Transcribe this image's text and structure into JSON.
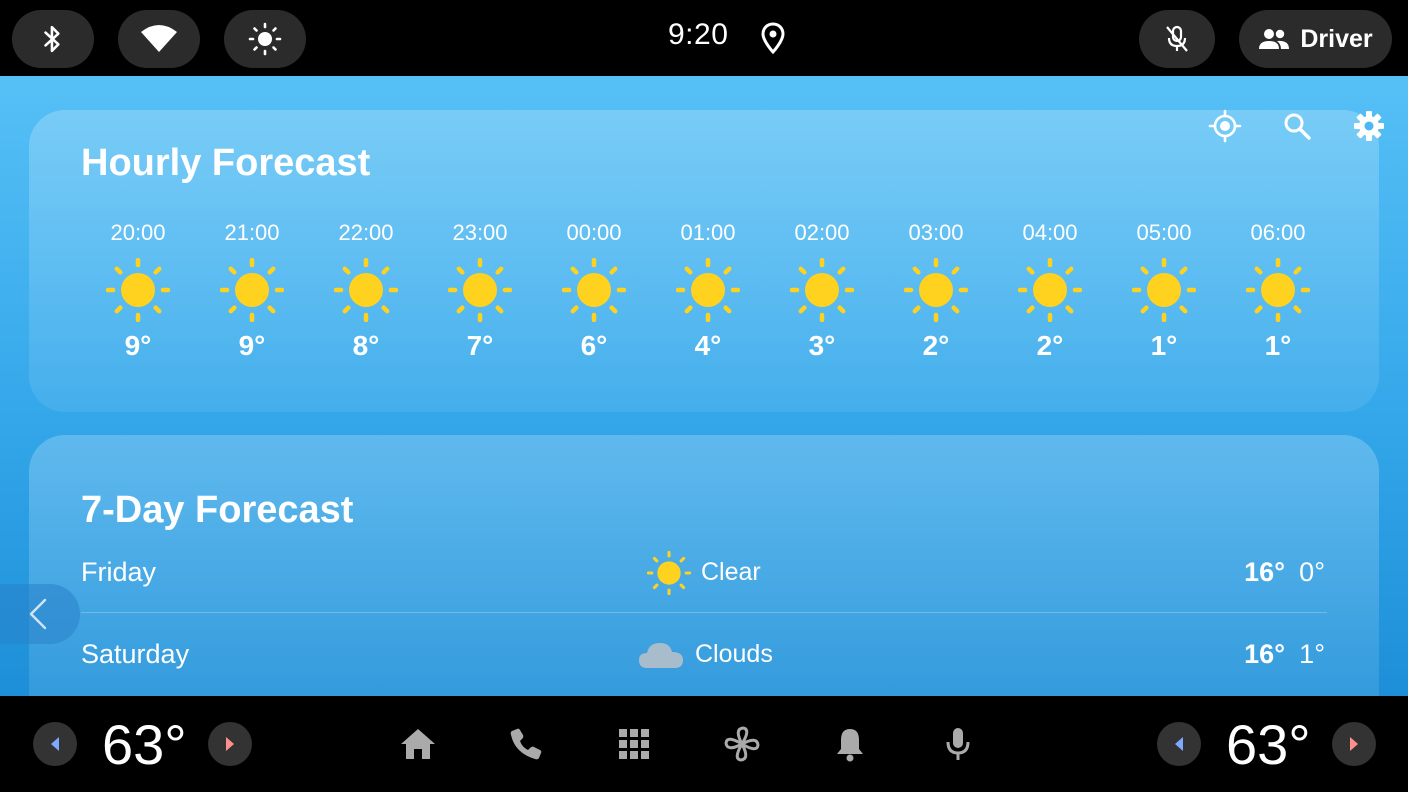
{
  "status_bar": {
    "time": "9:20",
    "driver_label": "Driver",
    "icons": [
      "bluetooth-icon",
      "wifi-icon",
      "brightness-icon",
      "location-pin-icon",
      "mic-off-icon",
      "people-icon"
    ]
  },
  "hourly": {
    "title": "Hourly Forecast",
    "items": [
      {
        "time": "20:00",
        "temp": "9°",
        "icon": "sun-icon"
      },
      {
        "time": "21:00",
        "temp": "9°",
        "icon": "sun-icon"
      },
      {
        "time": "22:00",
        "temp": "8°",
        "icon": "sun-icon"
      },
      {
        "time": "23:00",
        "temp": "7°",
        "icon": "sun-icon"
      },
      {
        "time": "00:00",
        "temp": "6°",
        "icon": "sun-icon"
      },
      {
        "time": "01:00",
        "temp": "4°",
        "icon": "sun-icon"
      },
      {
        "time": "02:00",
        "temp": "3°",
        "icon": "sun-icon"
      },
      {
        "time": "03:00",
        "temp": "2°",
        "icon": "sun-icon"
      },
      {
        "time": "04:00",
        "temp": "2°",
        "icon": "sun-icon"
      },
      {
        "time": "05:00",
        "temp": "1°",
        "icon": "sun-icon"
      },
      {
        "time": "06:00",
        "temp": "1°",
        "icon": "sun-icon"
      }
    ]
  },
  "daily": {
    "title": "7-Day Forecast",
    "items": [
      {
        "day": "Friday",
        "condition": "Clear",
        "high": "16°",
        "low": "0°",
        "icon": "sun-icon"
      },
      {
        "day": "Saturday",
        "condition": "Clouds",
        "high": "16°",
        "low": "1°",
        "icon": "cloud-icon"
      }
    ]
  },
  "toolbar_icons": [
    "my-location-icon",
    "search-icon",
    "settings-icon"
  ],
  "nav_bar": {
    "left_temp": "63°",
    "right_temp": "63°",
    "icons": [
      "home-icon",
      "phone-icon",
      "apps-grid-icon",
      "fan-icon",
      "bell-icon",
      "mic-icon"
    ]
  },
  "colors": {
    "sun": "#ffd21f",
    "cloud": "#a9bccc",
    "sky_top": "#56c0f6",
    "sky_bottom": "#1c8fd8",
    "temp_arrow_left": "#7fa9ff",
    "temp_arrow_right": "#ff8f8f"
  }
}
